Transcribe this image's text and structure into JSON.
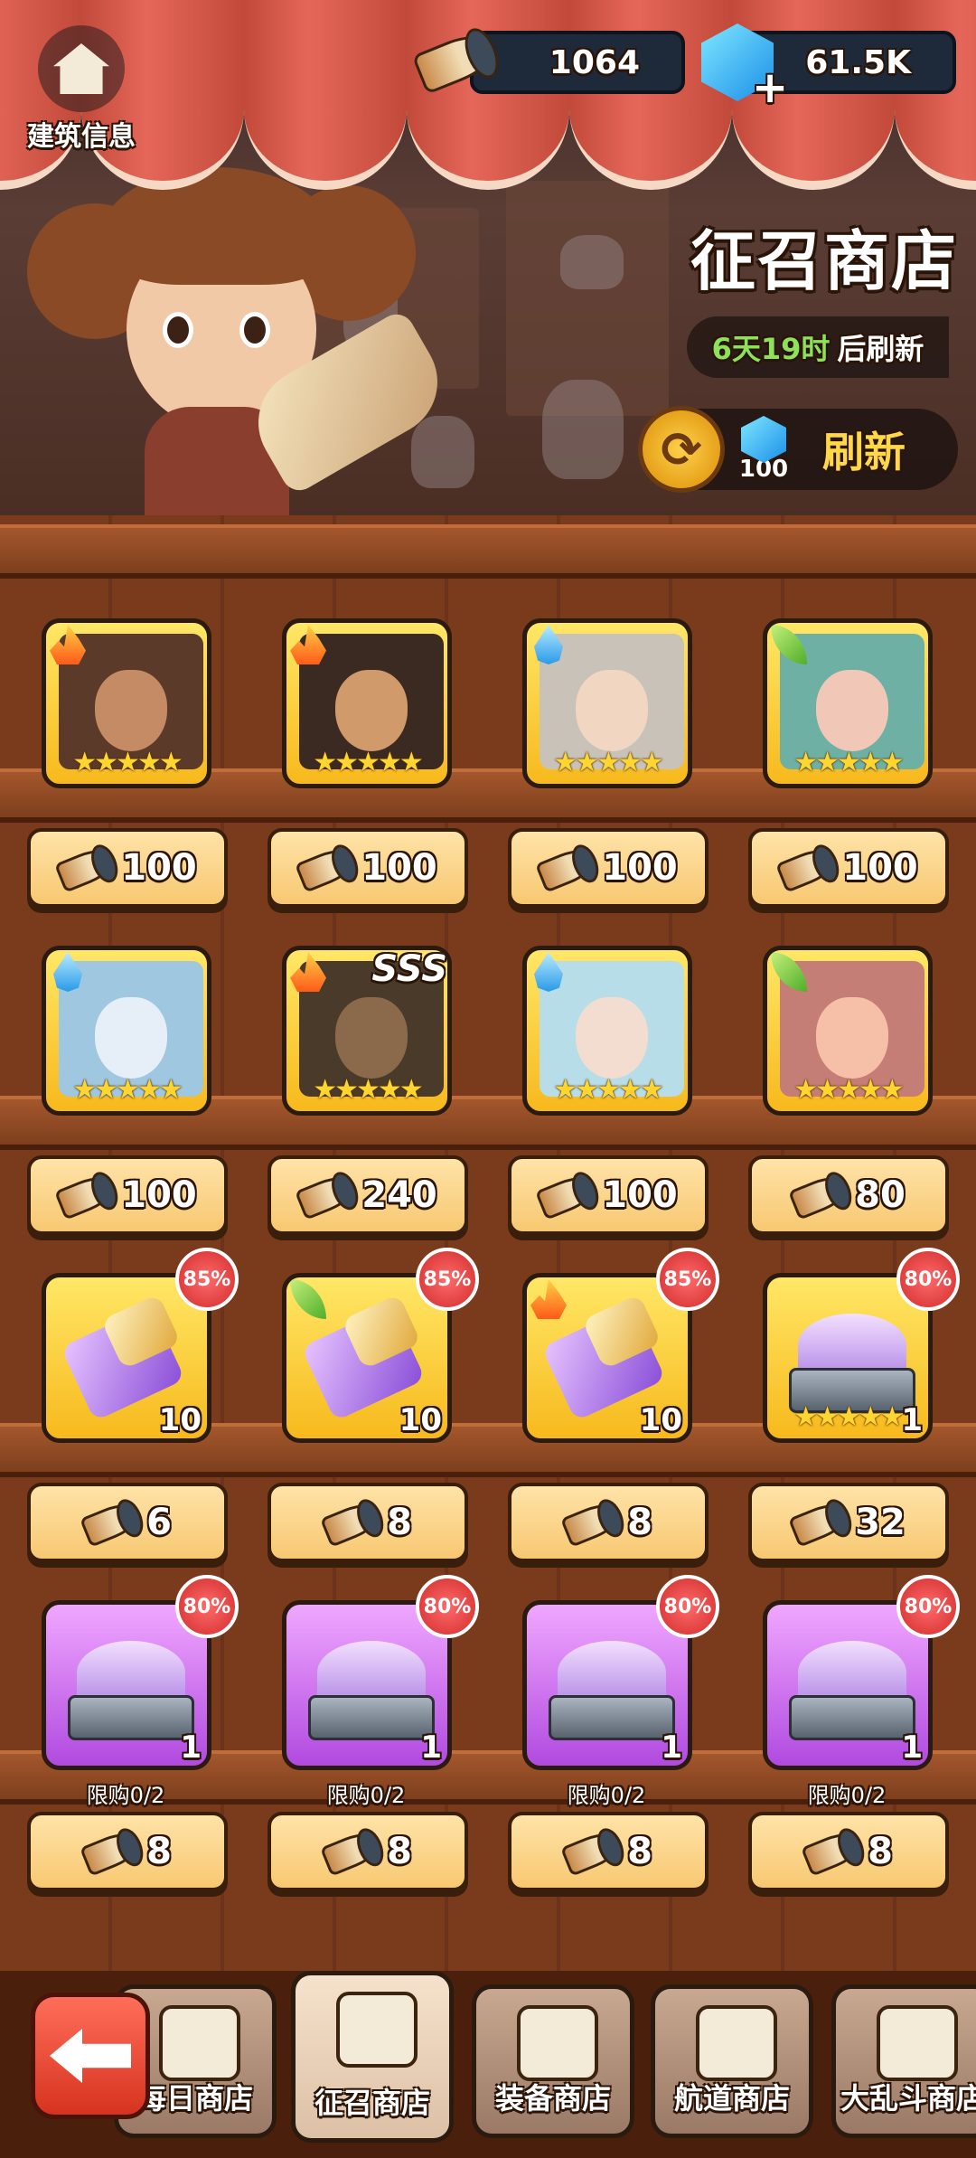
{
  "header": {
    "building_info_label": "建筑信息",
    "horn_currency": "1064",
    "gem_currency": "61.5K",
    "shop_title": "征召商店",
    "refresh_timer_value": "6天19时",
    "refresh_timer_suffix": "后刷新",
    "refresh_cost": "100",
    "refresh_label": "刷新"
  },
  "colors": {
    "accent_green": "#8ee25a",
    "accent_yellow": "#ffd84a",
    "discount_red": "#d12b2b"
  },
  "rows": [
    {
      "items": [
        {
          "type": "hero",
          "element": "fire",
          "stars": "★★★★★",
          "price": "100"
        },
        {
          "type": "hero",
          "element": "fire",
          "stars": "★★★★★",
          "price": "100"
        },
        {
          "type": "hero",
          "element": "water",
          "stars": "★★★★★",
          "price": "100"
        },
        {
          "type": "hero",
          "element": "leaf",
          "stars": "★★★★★",
          "price": "100"
        }
      ]
    },
    {
      "items": [
        {
          "type": "hero",
          "element": "water",
          "stars": "★★★★★",
          "price": "100"
        },
        {
          "type": "hero",
          "element": "fire",
          "stars": "★★★★★",
          "badge": "SSS",
          "price": "240"
        },
        {
          "type": "hero",
          "element": "water",
          "stars": "★★★★★",
          "price": "100"
        },
        {
          "type": "hero",
          "element": "leaf",
          "stars": "★★★★★",
          "price": "80"
        }
      ]
    },
    {
      "items": [
        {
          "type": "fragment",
          "element": "none",
          "discount": "85%",
          "qty": "10",
          "price": "6"
        },
        {
          "type": "fragment",
          "element": "leaf",
          "discount": "85%",
          "qty": "10",
          "price": "8"
        },
        {
          "type": "fragment",
          "element": "fire",
          "discount": "85%",
          "qty": "10",
          "price": "8"
        },
        {
          "type": "chest",
          "discount": "80%",
          "qty": "1",
          "stars": "★★★★★",
          "price": "32"
        }
      ]
    },
    {
      "items": [
        {
          "type": "chest-purple",
          "discount": "80%",
          "qty": "1",
          "limit": "限购0/2",
          "price": "8"
        },
        {
          "type": "chest-purple",
          "discount": "80%",
          "qty": "1",
          "limit": "限购0/2",
          "price": "8"
        },
        {
          "type": "chest-purple",
          "discount": "80%",
          "qty": "1",
          "limit": "限购0/2",
          "price": "8"
        },
        {
          "type": "chest-purple",
          "discount": "80%",
          "qty": "1",
          "limit": "限购0/2",
          "price": "8"
        }
      ]
    }
  ],
  "bottom_nav": {
    "tabs": [
      {
        "label": "每日商店",
        "icon": "store-icon"
      },
      {
        "label": "征召商店",
        "icon": "horn-icon"
      },
      {
        "label": "装备商店",
        "icon": "shirt-icon"
      },
      {
        "label": "航道商店",
        "icon": "anchor-icon"
      },
      {
        "label": "大乱斗商店",
        "icon": "3v3-store-icon"
      }
    ]
  }
}
